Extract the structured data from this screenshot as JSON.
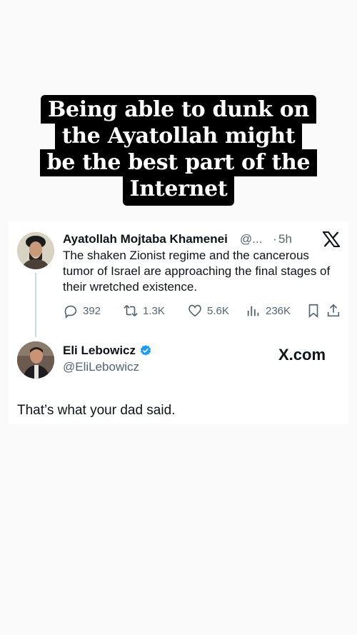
{
  "caption": {
    "lines": [
      "Being able to dunk on",
      "the Ayatollah  might",
      "be the best part of the",
      "Internet"
    ]
  },
  "original_tweet": {
    "display_name": "Ayatollah Mojtaba Khamenei",
    "handle": "@...",
    "separator": "·",
    "time": "5h",
    "platform_icon": "x-logo-icon",
    "text": "The shaken Zionist regime and the cancerous tumor of Israel are approaching the final stages of their wretched existence.",
    "stats": {
      "replies": "392",
      "retweets": "1.3K",
      "likes": "5.6K",
      "views": "236K"
    }
  },
  "reply_tweet": {
    "display_name": "Eli Lebowicz",
    "verified": true,
    "handle": "@EliLebowicz",
    "brand": "X.com",
    "text": "That’s what your dad said."
  },
  "colors": {
    "caption_bg": "#000000",
    "caption_text": "#ffffff",
    "primary_text": "#0f1419",
    "secondary_text": "#536471",
    "verified_blue": "#1d9bf0",
    "thread_line": "#cfd9de"
  }
}
